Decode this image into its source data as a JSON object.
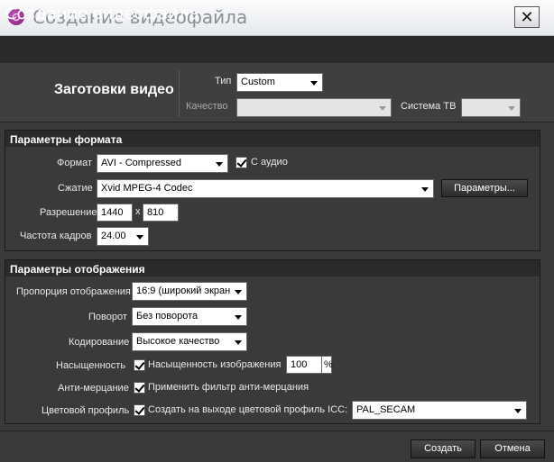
{
  "window": {
    "title": "Создание видеофайла",
    "close_glyph": "✕"
  },
  "header": {
    "title": "Создание видеофайла"
  },
  "presets": {
    "title": "Заготовки видео",
    "type_label": "Тип",
    "type_value": "Custom",
    "quality_label": "Качество",
    "quality_value": "",
    "tv_system_label": "Система ТВ",
    "tv_system_value": ""
  },
  "format": {
    "title": "Параметры формата",
    "format_label": "Формат",
    "format_value": "AVI - Compressed",
    "audio_label": "С аудио",
    "audio_checked": true,
    "compression_label": "Сжатие",
    "compression_value": "Xvid MPEG-4 Codec",
    "params_button": "Параметры...",
    "resolution_label": "Разрешение",
    "width": "1440",
    "x_sep": "x",
    "height": "810",
    "framerate_label": "Частота кадров",
    "framerate_value": "24.00"
  },
  "display": {
    "title": "Параметры отображения",
    "aspect_label": "Пропорция отображения",
    "aspect_value": "16:9 (широкий экран",
    "rotation_label": "Поворот",
    "rotation_value": "Без поворота",
    "encoding_label": "Кодирование",
    "encoding_value": "Высокое качество",
    "saturation_label": "Насыщенность",
    "saturation_check_label": "Насыщенность изображения",
    "saturation_value": "100",
    "saturation_unit": "%",
    "antiflicker_label": "Анти-мерцание",
    "antiflicker_check_label": "Применить фильтр анти-мерцания",
    "profile_label": "Цветовой профиль",
    "profile_check_label": "Создать на выходе цветовой профиль ICC:",
    "profile_value": "PAL_SECAM"
  },
  "footer": {
    "create_button": "Создать",
    "cancel_button": "Отмена"
  }
}
